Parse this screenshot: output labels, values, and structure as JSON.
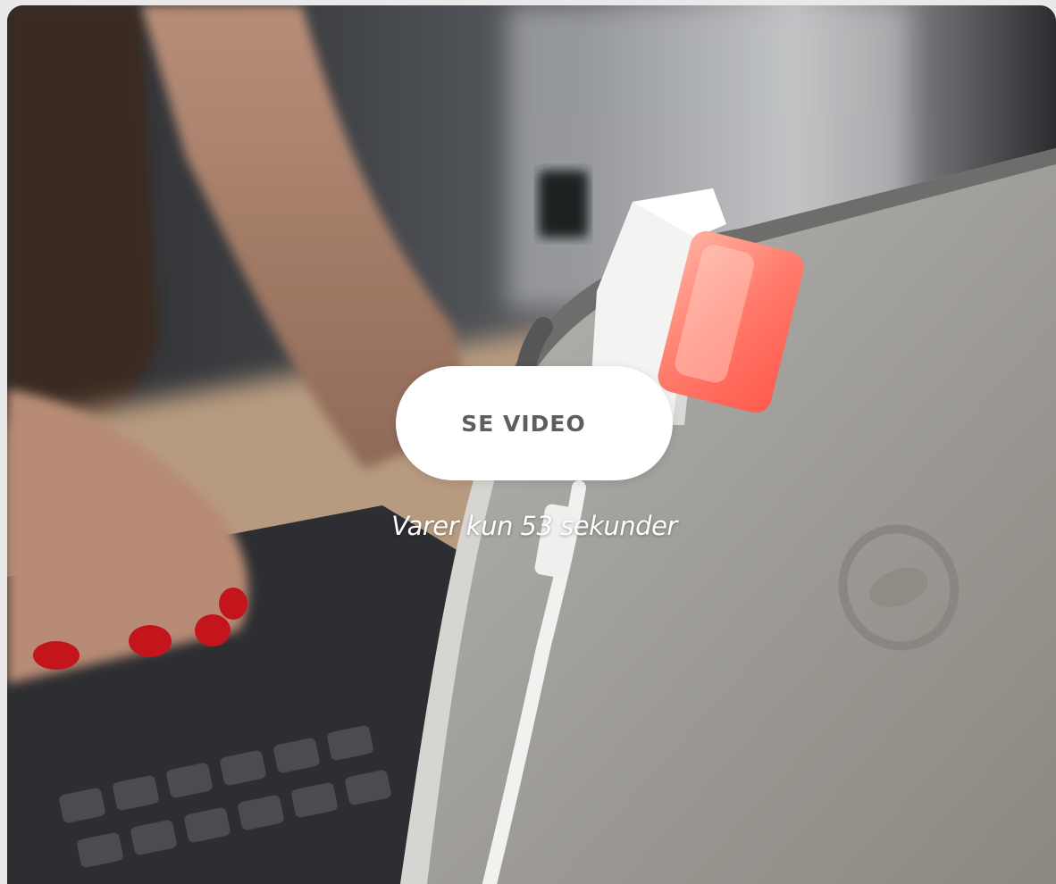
{
  "video_card": {
    "button_label": "SE VIDEO",
    "caption": "Varer kun 53 sekunder",
    "accent_colors": {
      "button_bg": "#ffffff",
      "button_text": "#5c5e62",
      "caption_text": "#ffffff",
      "indicator_light": "#ff7a6a"
    }
  }
}
